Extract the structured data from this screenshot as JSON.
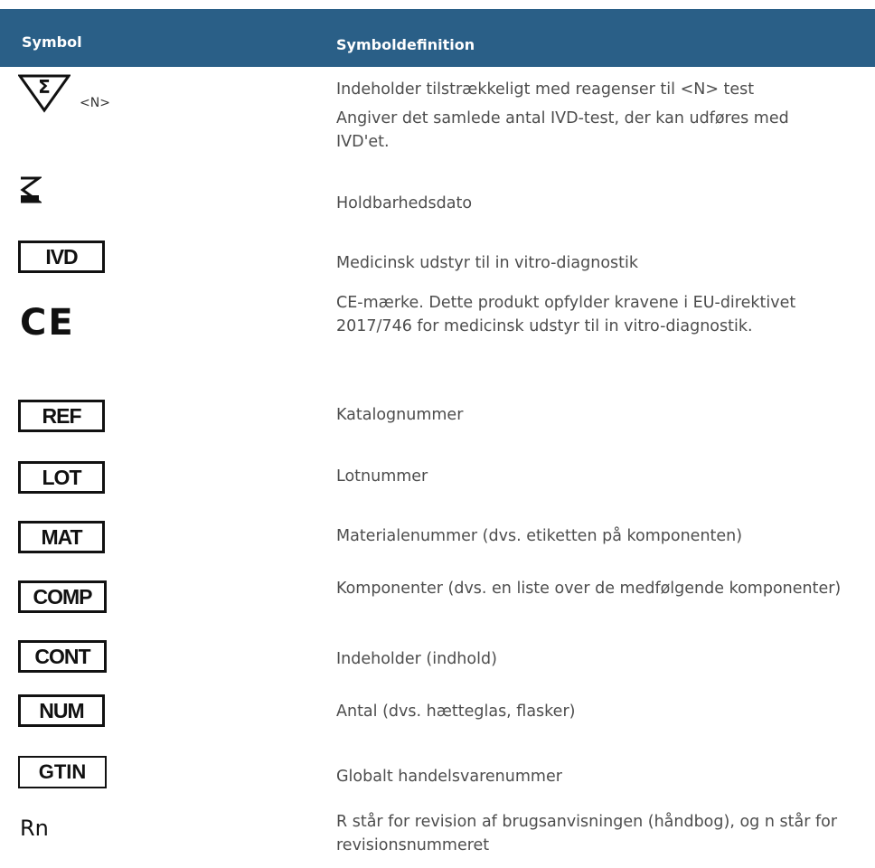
{
  "header": {
    "symbol": "Symbol",
    "definition": "Symboldefinition"
  },
  "rows": [
    {
      "symbol_icon": "sigma-n-tests-icon",
      "symbol_text": "<N>",
      "definition": [
        "Indeholder tilstrækkeligt med reagenser til <N> test",
        "Angiver det samlede antal IVD-test, der kan udføres med IVD'et."
      ]
    },
    {
      "symbol_icon": "hourglass-icon",
      "definition": [
        "Holdbarhedsdato"
      ]
    },
    {
      "symbol_text": "IVD",
      "definition": [
        "Medicinsk udstyr til in vitro-diagnostik"
      ]
    },
    {
      "symbol_icon": "ce-mark-icon",
      "symbol_text": "CE",
      "definition": [
        "CE-mærke. Dette produkt opfylder kravene i EU-direktivet 2017/746 for medicinsk udstyr til in vitro-diagnostik."
      ]
    },
    {
      "symbol_text": "REF",
      "definition": [
        "Katalognummer"
      ]
    },
    {
      "symbol_text": "LOT",
      "definition": [
        "Lotnummer"
      ]
    },
    {
      "symbol_text": "MAT",
      "definition": [
        "Materialenummer (dvs. etiketten på komponenten)"
      ]
    },
    {
      "symbol_text": "COMP",
      "definition": [
        "Komponenter (dvs. en liste over de medfølgende komponenter)"
      ]
    },
    {
      "symbol_text": "CONT",
      "definition": [
        "Indeholder (indhold)"
      ]
    },
    {
      "symbol_text": "NUM",
      "definition": [
        "Antal (dvs. hætteglas, flasker)"
      ]
    },
    {
      "symbol_text": "GTIN",
      "definition": [
        "Globalt handelsvarenummer"
      ]
    },
    {
      "symbol_text": "Rn",
      "definition": [
        "R står for revision af brugsanvisningen (håndbog), og n står for revisionsnummeret"
      ]
    }
  ]
}
